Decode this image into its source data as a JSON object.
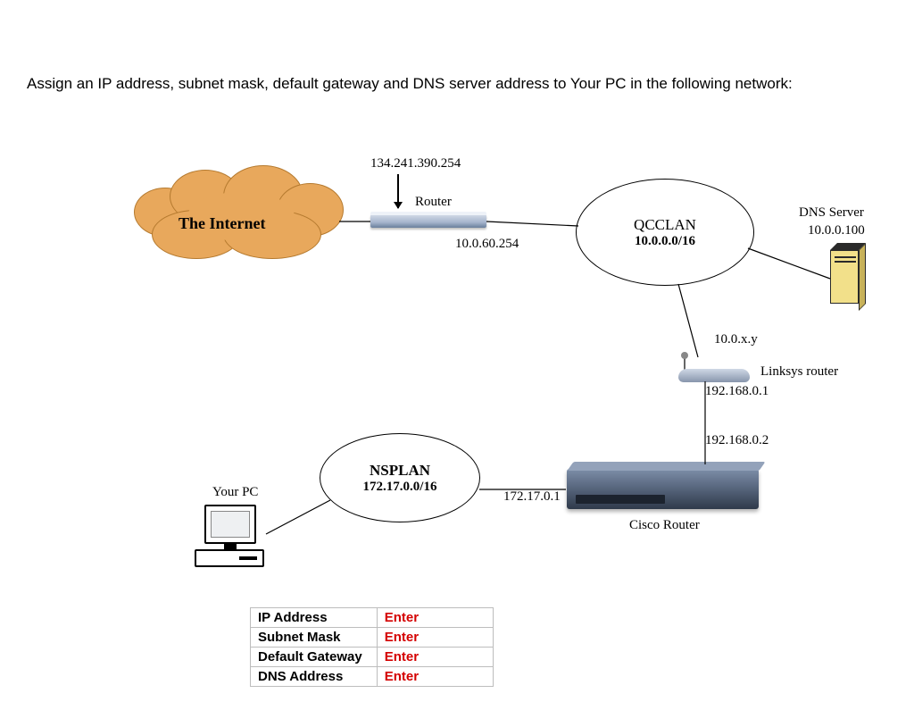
{
  "instruction": "Assign an IP address, subnet mask, default gateway and DNS server address to Your PC in the following network:",
  "labels": {
    "internet": "The Internet",
    "router_ip_wan": "134.241.390.254",
    "router_text": "Router",
    "router_ip_lan": "10.0.60.254",
    "qcclan_name": "QCCLAN",
    "qcclan_net": "10.0.0.0/16",
    "dns_title": "DNS Server",
    "dns_ip": "10.0.0.100",
    "linksys_wan": "10.0.x.y",
    "linksys_text": "Linksys router",
    "linksys_lan": "192.168.0.1",
    "cisco_wan": "192.168.0.2",
    "cisco_lan_ip": "172.17.0.1",
    "cisco_text": "Cisco Router",
    "nsplan_name": "NSPLAN",
    "nsplan_net": "172.17.0.0/16",
    "your_pc": "Your PC"
  },
  "table": {
    "rows": [
      {
        "k": "IP Address",
        "v": "Enter"
      },
      {
        "k": "Subnet Mask",
        "v": "Enter"
      },
      {
        "k": "Default Gateway",
        "v": "Enter"
      },
      {
        "k": "DNS Address",
        "v": "Enter"
      }
    ]
  }
}
